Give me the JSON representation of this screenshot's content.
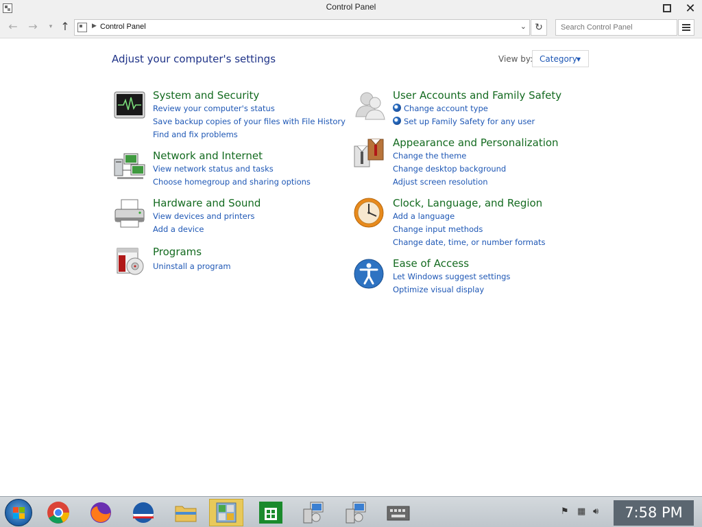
{
  "window": {
    "title": "Control Panel"
  },
  "address_bar": {
    "breadcrumb": "Control Panel",
    "search_placeholder": "Search Control Panel"
  },
  "main": {
    "heading": "Adjust your computer's settings",
    "view_by_label": "View by:",
    "view_by_value": "Category",
    "categories": [
      {
        "title": "System and Security",
        "icon": "system-security-icon",
        "links": [
          "Review your computer's status",
          "Save backup copies of your files with File History",
          "Find and fix problems"
        ]
      },
      {
        "title": "Network and Internet",
        "icon": "network-icon",
        "links": [
          "View network status and tasks",
          "Choose homegroup and sharing options"
        ]
      },
      {
        "title": "Hardware and Sound",
        "icon": "printer-icon",
        "links": [
          "View devices and printers",
          "Add a device"
        ]
      },
      {
        "title": "Programs",
        "icon": "programs-icon",
        "links": [
          "Uninstall a program"
        ]
      },
      {
        "title": "User Accounts and Family Safety",
        "icon": "users-icon",
        "links": [
          "Change account type",
          "Set up Family Safety for any user"
        ]
      },
      {
        "title": "Appearance and Personalization",
        "icon": "appearance-icon",
        "links": [
          "Change the theme",
          "Change desktop background",
          "Adjust screen resolution"
        ]
      },
      {
        "title": "Clock, Language, and Region",
        "icon": "clock-icon",
        "links": [
          "Add a language",
          "Change input methods",
          "Change date, time, or number formats"
        ]
      },
      {
        "title": "Ease of Access",
        "icon": "accessibility-icon",
        "links": [
          "Let Windows suggest settings",
          "Optimize visual display"
        ]
      }
    ]
  },
  "taskbar": {
    "clock": "7:58 PM",
    "items": [
      "start-icon",
      "chrome-icon",
      "firefox-icon",
      "opera-icon",
      "file-explorer-icon",
      "control-panel-icon",
      "store-icon",
      "network-app-icon",
      "network-app-icon-2",
      "keyboard-icon"
    ]
  }
}
